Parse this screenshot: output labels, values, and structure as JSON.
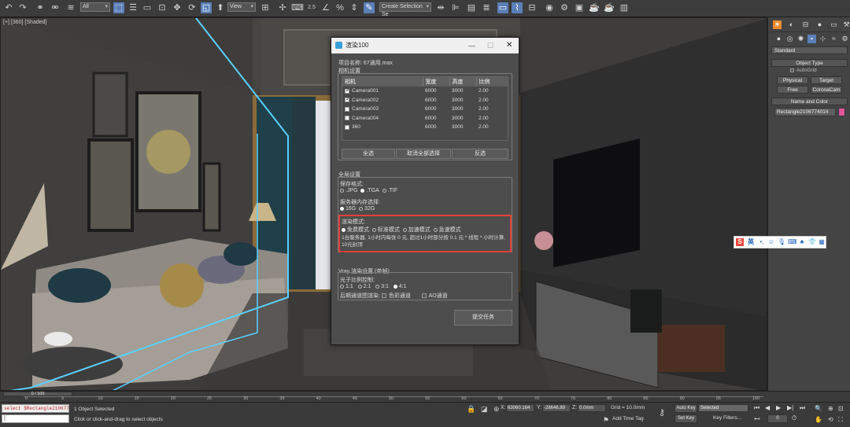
{
  "toolbar": {
    "selection_filter": "All",
    "ref_coord": "View",
    "selection_set": "Create Selection Se",
    "snap_label": "2.5"
  },
  "viewport": {
    "label": "[+] [360] [Shaded]"
  },
  "dialog": {
    "title": "渲染100",
    "project_label": "项目名称: 67通用.max",
    "camera_group": "相机设置",
    "columns": [
      "相机",
      "宽度",
      "高度",
      "比例"
    ],
    "cameras": [
      {
        "name": "Camera001",
        "width": "6000",
        "height": "3000",
        "ratio": "2.00",
        "checked": true
      },
      {
        "name": "Camera002",
        "width": "6000",
        "height": "3000",
        "ratio": "2.00",
        "checked": true
      },
      {
        "name": "Camera003",
        "width": "6000",
        "height": "3000",
        "ratio": "2.00",
        "checked": false
      },
      {
        "name": "Camera004",
        "width": "6000",
        "height": "3000",
        "ratio": "2.00",
        "checked": false
      },
      {
        "name": "360",
        "width": "6000",
        "height": "3000",
        "ratio": "2.00",
        "checked": false
      }
    ],
    "select_all": "全选",
    "deselect_all": "取消全部选择",
    "invert": "反选",
    "global_group": "全局设置",
    "save_format_label": "保存格式:",
    "formats": [
      ".JPG",
      ".TGA",
      ".TIF"
    ],
    "format_selected": ".TGA",
    "memory_label": "服务器内存选择:",
    "memory_options": [
      "16G",
      "32G"
    ],
    "memory_selected": "16G",
    "render_mode_label": "渲染模式:",
    "render_modes": [
      "免费模式",
      "标准模式",
      "加速模式",
      "急速模式"
    ],
    "render_mode_selected": "免费模式",
    "render_note": "1台服务器, 1小时内每张 0 元, 超过1小时部分按 0.1 元 * 线程 * 小时计算, 10元封顶",
    "vray_group": "Vray 渲染设置 (单帧)",
    "subdiv_label": "光子比例控制:",
    "ratios": [
      "1:1",
      "2:1",
      "3:1",
      "4:1"
    ],
    "ratio_selected": "4:1",
    "post_label": "后期通道图渲染:",
    "post_options": [
      "色彩通道",
      "AO通道"
    ],
    "submit": "提交任务"
  },
  "right_panel": {
    "dropdown": "Standard",
    "object_type": "Object Type",
    "autogrid": "AutoGrid",
    "buttons": [
      "Physical",
      "Target",
      "Free",
      "CoronaCam"
    ],
    "name_color": "Name and Color",
    "object_name": "Rectangle2106774014",
    "object_color": "#e0559a"
  },
  "timeline": {
    "frame": "0 / 100",
    "ticks": [
      "0",
      "5",
      "10",
      "15",
      "20",
      "25",
      "30",
      "35",
      "40",
      "45",
      "50",
      "55",
      "60",
      "65",
      "70",
      "75",
      "80",
      "85",
      "90",
      "95",
      "100"
    ]
  },
  "status": {
    "script": "select $Rectangle2106774",
    "selected": "1 Object Selected",
    "prompt": "Click or click-and-drag to select objects",
    "x_label": "X:",
    "x_value": "63060.164",
    "y_label": "Y:",
    "y_value": "-28646.89",
    "z_label": "Z:",
    "z_value": "0.0mm",
    "grid": "Grid = 10.0mm",
    "auto_key": "Auto Key",
    "set_key": "Set Key",
    "key_mode": "Selected",
    "add_time_tag": "Add Time Tag",
    "key_filters": "Key Filters...",
    "frame_field": "0"
  }
}
